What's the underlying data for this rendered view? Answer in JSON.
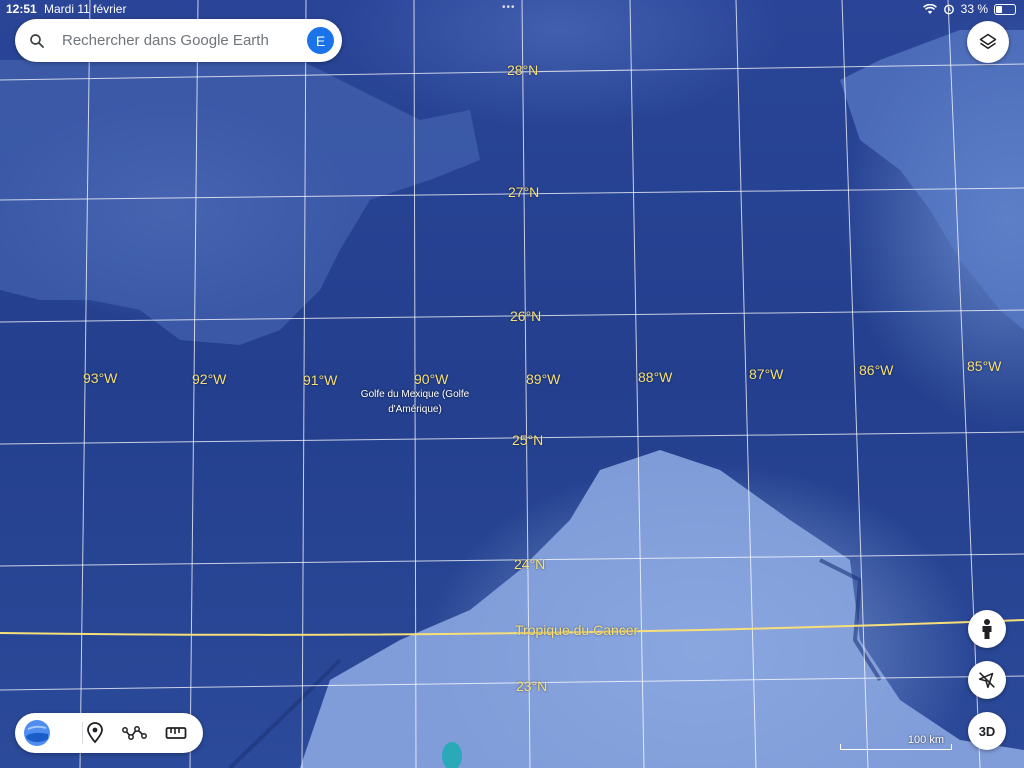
{
  "status_bar": {
    "time": "12:51",
    "date": "Mardi 11 février",
    "battery_percent": "33 %",
    "battery_level": 0.33,
    "dots": "•••"
  },
  "search": {
    "placeholder": "Rechercher dans Google Earth",
    "value": "",
    "avatar_letter": "E",
    "avatar_color": "#1a73e8"
  },
  "map": {
    "latitude_labels": [
      "28°N",
      "27°N",
      "26°N",
      "25°N",
      "24°N",
      "23°N"
    ],
    "longitude_labels": [
      "93°W",
      "92°W",
      "91°W",
      "90°W",
      "89°W",
      "88°W",
      "87°W",
      "86°W",
      "85°W"
    ],
    "place_label": "Golfe du Mexique (Golfe d'Amérique)",
    "tropic_label": "Tropique du Cancer",
    "grid_color": "#ffffff",
    "tropic_color": "#f6df7a",
    "label_color": "#f6df7a"
  },
  "controls": {
    "layers_icon": "layers-icon",
    "street_view_icon": "pegman-icon",
    "compass_icon": "compass-icon",
    "view_3d_label": "3D"
  },
  "toolbar": {
    "items": [
      "earth-icon",
      "placemark-icon",
      "path-icon",
      "ruler-icon"
    ]
  },
  "scale_bar": {
    "label": "100 km"
  }
}
